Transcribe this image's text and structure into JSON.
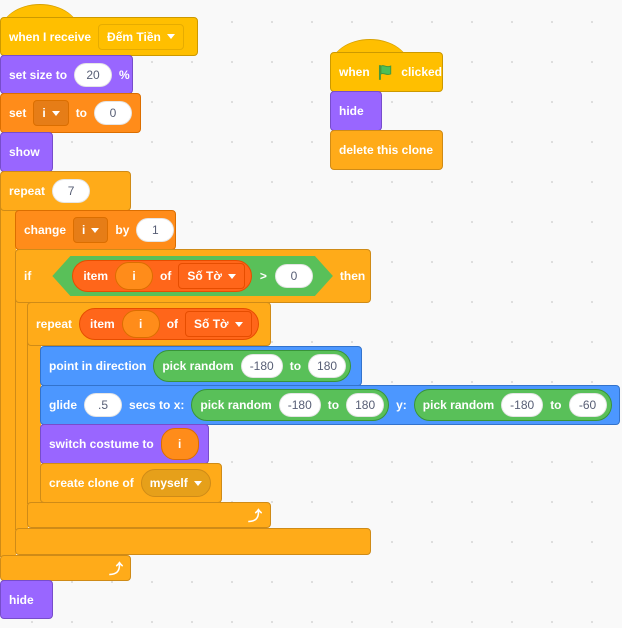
{
  "colors": {
    "events": "#ffbf00",
    "looks": "#9966ff",
    "control": "#ffab19",
    "variables": "#ff8c1a",
    "lists": "#ff661a",
    "motion": "#4c97ff",
    "operators": "#59c059"
  },
  "script1": {
    "receive": {
      "label": "when I receive",
      "message": "Đếm Tiền"
    },
    "set_size": {
      "label": "set size to",
      "value": "20",
      "unit": "%"
    },
    "set_var": {
      "label": "set",
      "var": "i",
      "to": "to",
      "value": "0"
    },
    "show": "show",
    "repeat": {
      "label": "repeat",
      "value": "7"
    },
    "change": {
      "label": "change",
      "var": "i",
      "by": "by",
      "value": "1"
    },
    "if": {
      "label": "if",
      "item": "item",
      "index": "i",
      "of": "of",
      "list": "Số Tờ",
      "gt": ">",
      "value": "0",
      "then": "then"
    },
    "repeat2": {
      "label": "repeat",
      "item": "item",
      "index": "i",
      "of": "of",
      "list": "Số Tờ"
    },
    "point": {
      "label": "point in direction",
      "random": "pick random",
      "from": "-180",
      "to": "to",
      "until": "180"
    },
    "glide": {
      "label": "glide",
      "secs": ".5",
      "secs_label": "secs to x:",
      "random1": "pick random",
      "x_from": "-180",
      "to1": "to",
      "x_to": "180",
      "y_label": "y:",
      "random2": "pick random",
      "y_from": "-180",
      "to2": "to",
      "y_to": "-60"
    },
    "costume": {
      "label": "switch costume to",
      "var": "i"
    },
    "clone": {
      "label": "create clone of",
      "target": "myself"
    },
    "hide": "hide"
  },
  "script2": {
    "flag": {
      "when": "when",
      "clicked": "clicked",
      "icon": "green-flag-icon"
    },
    "hide": "hide",
    "delete": "delete this clone"
  }
}
